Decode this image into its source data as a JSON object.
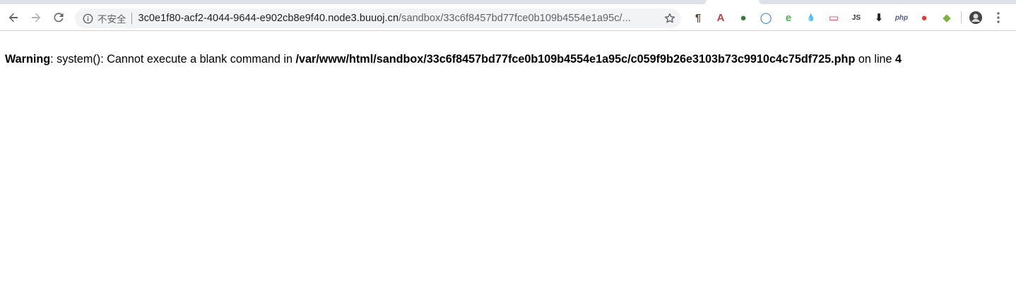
{
  "browser": {
    "insecure_label": "不安全",
    "url_host": "3c0e1f80-acf2-4044-9644-e902cb8e9f40.node3.buuoj.cn",
    "url_path": "/sandbox/33c6f8457bd77fce0b109b4554e1a95c/...",
    "extensions": [
      {
        "name": "pilcrow-extension-icon",
        "glyph": "¶",
        "color": "#5a4a2a"
      },
      {
        "name": "pdf-extension-icon",
        "glyph": "A",
        "color": "#b24a40"
      },
      {
        "name": "green-globe-extension-icon",
        "glyph": "●",
        "color": "#2e7d32"
      },
      {
        "name": "blue-ring-extension-icon",
        "glyph": "◯",
        "color": "#1a73e8"
      },
      {
        "name": "e-extension-icon",
        "glyph": "e",
        "color": "#4caf50"
      },
      {
        "name": "droplet-extension-icon",
        "glyph": "💧",
        "color": "#1565c0"
      },
      {
        "name": "red-badge-extension-icon",
        "glyph": "▭",
        "color": "#e53935"
      },
      {
        "name": "js-extension-icon",
        "glyph": "JS",
        "color": "#333333"
      },
      {
        "name": "download-arrow-extension-icon",
        "glyph": "⬇",
        "color": "#202124"
      },
      {
        "name": "php-extension-icon",
        "glyph": "php",
        "color": "#4f5b93"
      },
      {
        "name": "cookie-extension-icon",
        "glyph": "●",
        "color": "#e53935"
      },
      {
        "name": "cube-extension-icon",
        "glyph": "◆",
        "color": "#7cb342"
      }
    ]
  },
  "page": {
    "warning_label": "Warning",
    "warning_message": ": system(): Cannot execute a blank command in ",
    "file_path": "/var/www/html/sandbox/33c6f8457bd77fce0b109b4554e1a95c/c059f9b26e3103b73c9910c4c75df725.php",
    "on_line_text": " on line ",
    "line_number": "4"
  },
  "colors": {
    "omnibox_bg": "#f1f3f4",
    "tab_strip": "#dee1e6"
  }
}
